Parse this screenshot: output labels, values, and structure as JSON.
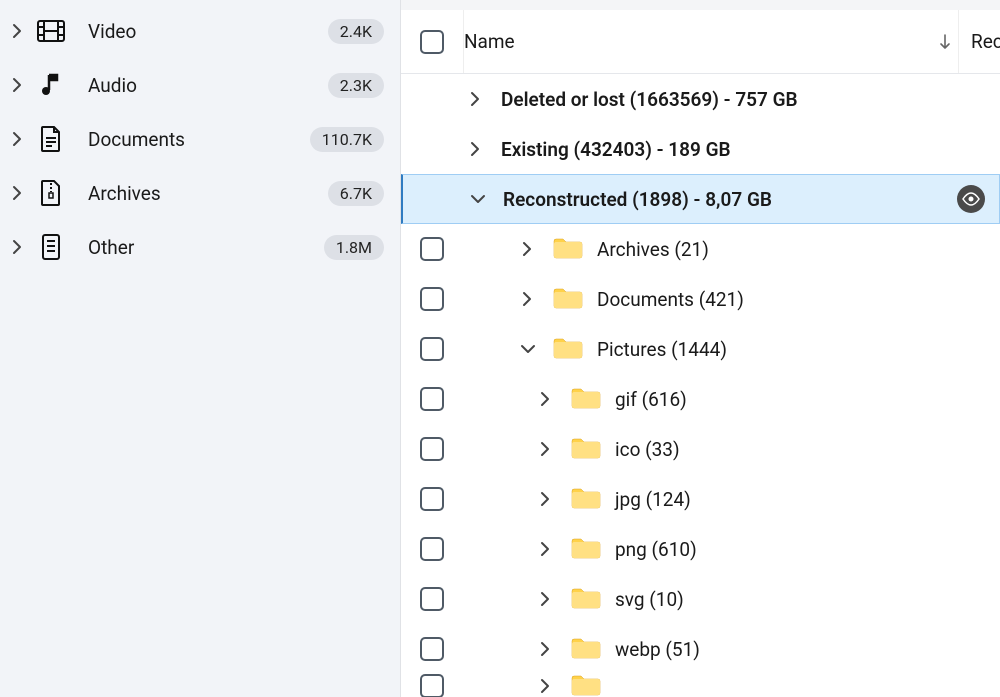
{
  "sidebar": {
    "items": [
      {
        "label": "Video",
        "count": "2.4K"
      },
      {
        "label": "Audio",
        "count": "2.3K"
      },
      {
        "label": "Documents",
        "count": "110.7K"
      },
      {
        "label": "Archives",
        "count": "6.7K"
      },
      {
        "label": "Other",
        "count": "1.8M"
      }
    ]
  },
  "header": {
    "name_col": "Name",
    "rec_col": "Rec"
  },
  "tree": {
    "deleted": "Deleted or lost (1663569) - 757 GB",
    "existing": "Existing (432403) - 189 GB",
    "reconstructed": "Reconstructed (1898) - 8,07 GB",
    "children": {
      "archives": "Archives (21)",
      "documents": "Documents (421)",
      "pictures": "Pictures (1444)",
      "pic": {
        "gif": "gif (616)",
        "ico": "ico (33)",
        "jpg": "jpg (124)",
        "png": "png (610)",
        "svg": "svg (10)",
        "webp": "webp (51)"
      }
    }
  }
}
